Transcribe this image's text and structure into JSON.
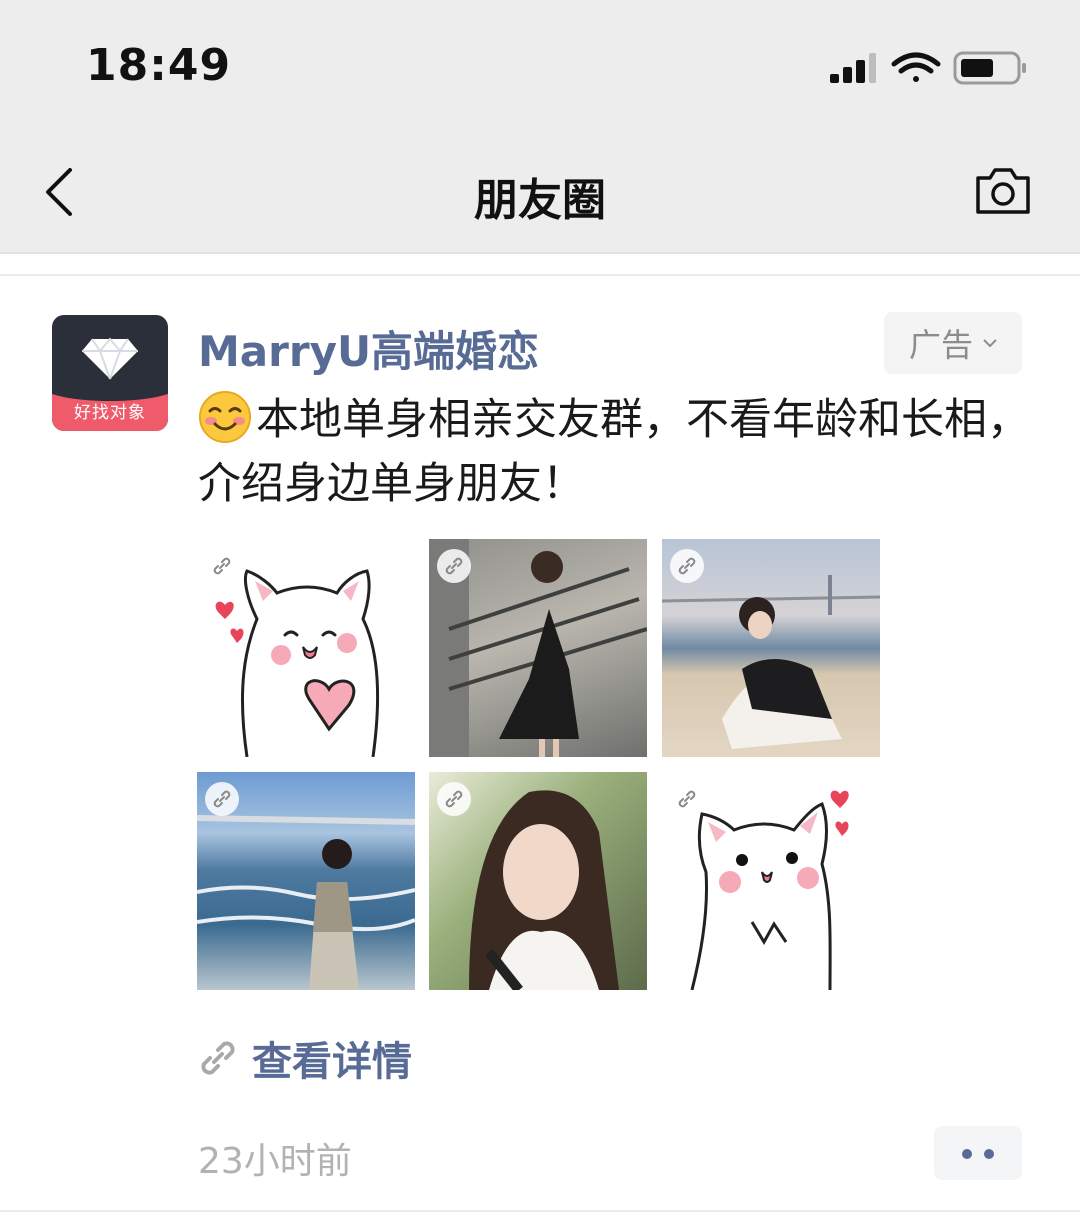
{
  "status_bar": {
    "time": "18:49",
    "icons": [
      "signal-icon",
      "wifi-icon",
      "battery-icon"
    ]
  },
  "nav": {
    "title": "朋友圈",
    "back_icon": "chevron-left-icon",
    "camera_icon": "camera-icon"
  },
  "post": {
    "avatar_label": "好找对象",
    "account_name": "MarryU高端婚恋",
    "ad_label": "广告",
    "text": "本地单身相亲交友群，不看年龄和长相，介绍身边单身朋友！",
    "images": [
      {
        "name": "sticker-cat-heart"
      },
      {
        "name": "photo-girl-stairs"
      },
      {
        "name": "photo-girl-beach-bridge"
      },
      {
        "name": "photo-girl-sea"
      },
      {
        "name": "photo-girl-portrait"
      },
      {
        "name": "sticker-cat-pray"
      }
    ],
    "detail_link": "查看详情",
    "time_ago": "23小时前"
  },
  "colors": {
    "link_blue": "#576b95",
    "nav_bg": "#ededed",
    "brand_red": "#ef5b6b"
  }
}
